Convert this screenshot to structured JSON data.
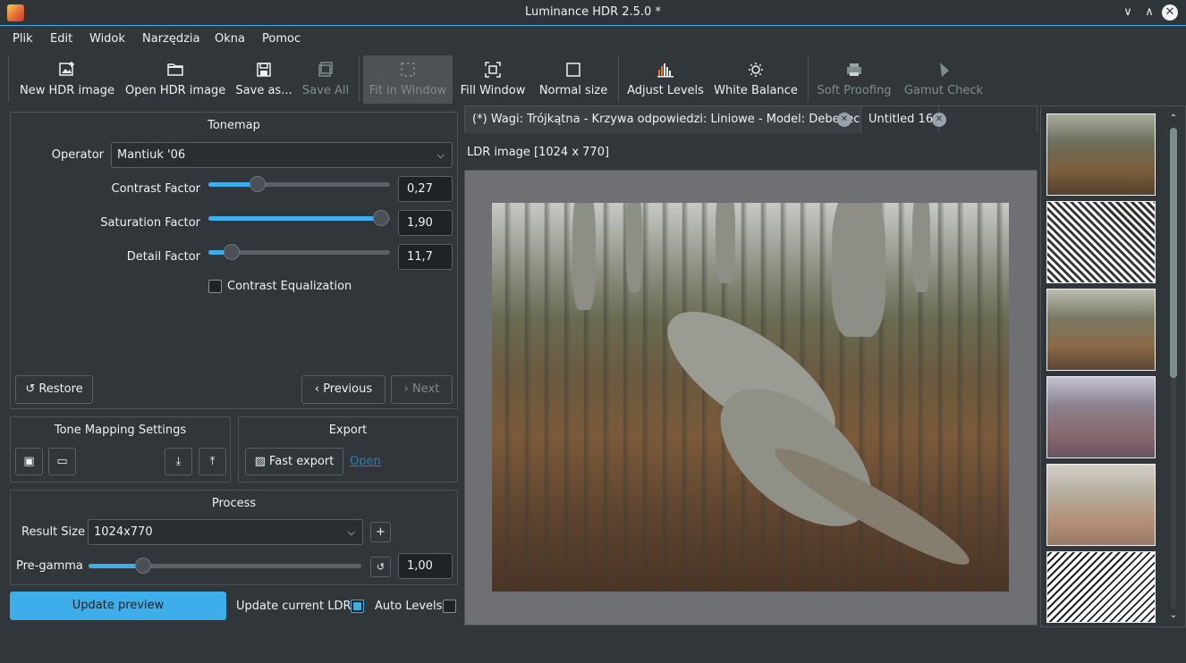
{
  "window": {
    "title": "Luminance HDR 2.5.0 *",
    "min": "∨",
    "max": "∧",
    "close": "✕"
  },
  "menu": [
    "Plik",
    "Edit",
    "Widok",
    "Narzędzia",
    "Okna",
    "Pomoc"
  ],
  "toolbar": {
    "new_hdr": "New HDR image",
    "open_hdr": "Open HDR image",
    "save_as": "Save as...",
    "save_all": "Save All",
    "fit_window": "Fit in Window",
    "fill_window": "Fill Window",
    "normal_size": "Normal size",
    "adjust_levels": "Adjust Levels",
    "white_balance": "White Balance",
    "soft_proofing": "Soft Proofing",
    "gamut_check": "Gamut Check"
  },
  "tonemap": {
    "title": "Tonemap",
    "operator_label": "Operator",
    "operator_value": "Mantiuk '06",
    "contrast_label": "Contrast Factor",
    "contrast_value": "0,27",
    "contrast_level": 0.27,
    "saturation_label": "Saturation Factor",
    "saturation_value": "1,90",
    "saturation_level": 0.95,
    "detail_label": "Detail Factor",
    "detail_value": "11,7",
    "detail_level": 0.13,
    "equalization_label": "Contrast Equalization",
    "restore": "Restore",
    "previous": "Previous",
    "next": "Next"
  },
  "tms": {
    "title": "Tone Mapping Settings"
  },
  "export": {
    "title": "Export",
    "fast_export": "Fast export",
    "open": "Open"
  },
  "process": {
    "title": "Process",
    "result_label": "Result Size",
    "result_value": "1024x770",
    "add": "+",
    "pregamma_label": "Pre-gamma",
    "pregamma_value": "1,00",
    "pregamma_level": 0.2,
    "reset": "↺"
  },
  "bottom": {
    "update_preview": "Update preview",
    "update_current": "Update current LDR",
    "auto_levels": "Auto Levels"
  },
  "tabs": [
    {
      "label": "(*) Wagi: Trójkątna - Krzywa odpowiedzi: Liniowe - Model: Debevec"
    },
    {
      "label": "Untitled 16"
    }
  ],
  "viewer": {
    "caption": "LDR image [1024 x 770]"
  }
}
